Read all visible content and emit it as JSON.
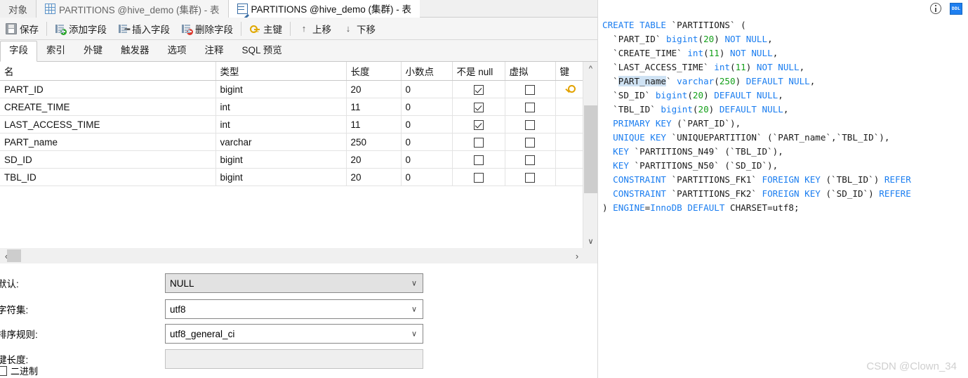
{
  "tabs": [
    {
      "label": "对象",
      "icon": "none",
      "state": "plain"
    },
    {
      "label": "PARTITIONS @hive_demo (集群) - 表",
      "icon": "grid-table-icon",
      "state": "inactive"
    },
    {
      "label": "PARTITIONS @hive_demo (集群) - 表",
      "icon": "design-table-icon",
      "state": "active"
    }
  ],
  "toolbar": {
    "save": "保存",
    "add_field": "添加字段",
    "insert_field": "插入字段",
    "delete_field": "删除字段",
    "primary_key": "主键",
    "move_up": "上移",
    "move_down": "下移"
  },
  "subtabs": [
    {
      "label": "字段",
      "active": true
    },
    {
      "label": "索引",
      "active": false
    },
    {
      "label": "外键",
      "active": false
    },
    {
      "label": "触发器",
      "active": false
    },
    {
      "label": "选项",
      "active": false
    },
    {
      "label": "注释",
      "active": false
    },
    {
      "label": "SQL 预览",
      "active": false
    }
  ],
  "grid": {
    "columns": [
      "名",
      "类型",
      "长度",
      "小数点",
      "不是 null",
      "虚拟",
      "键"
    ],
    "rows": [
      {
        "name": "PART_ID",
        "type": "bigint",
        "length": "20",
        "decimals": "0",
        "not_null": true,
        "virtual": false,
        "key": "primary-key-icon"
      },
      {
        "name": "CREATE_TIME",
        "type": "int",
        "length": "11",
        "decimals": "0",
        "not_null": true,
        "virtual": false,
        "key": ""
      },
      {
        "name": "LAST_ACCESS_TIME",
        "type": "int",
        "length": "11",
        "decimals": "0",
        "not_null": true,
        "virtual": false,
        "key": ""
      },
      {
        "name": "PART_name",
        "type": "varchar",
        "length": "250",
        "decimals": "0",
        "not_null": false,
        "virtual": false,
        "key": ""
      },
      {
        "name": "SD_ID",
        "type": "bigint",
        "length": "20",
        "decimals": "0",
        "not_null": false,
        "virtual": false,
        "key": ""
      },
      {
        "name": "TBL_ID",
        "type": "bigint",
        "length": "20",
        "decimals": "0",
        "not_null": false,
        "virtual": false,
        "key": ""
      }
    ]
  },
  "properties": {
    "default_label": "默认:",
    "default_value": "NULL",
    "charset_label": "字符集:",
    "charset_value": "utf8",
    "collation_label": "排序规则:",
    "collation_value": "utf8_general_ci",
    "keylen_label": "键长度:",
    "keylen_value": "",
    "binary_label": "二进制",
    "binary_checked": false
  },
  "right_panel": {
    "info_icon": "info-icon",
    "ddl_button": "DDL"
  },
  "sql": {
    "lines": [
      [
        {
          "t": "CREATE",
          "c": "k"
        },
        {
          "t": " ",
          "c": "p"
        },
        {
          "t": "TABLE",
          "c": "k"
        },
        {
          "t": " `PARTITIONS` (",
          "c": "id"
        }
      ],
      [
        {
          "t": "  `PART_ID` ",
          "c": "id"
        },
        {
          "t": "bigint",
          "c": "t"
        },
        {
          "t": "(",
          "c": "id"
        },
        {
          "t": "20",
          "c": "n"
        },
        {
          "t": ") ",
          "c": "id"
        },
        {
          "t": "NOT NULL",
          "c": "k"
        },
        {
          "t": ",",
          "c": "id"
        }
      ],
      [
        {
          "t": "  `CREATE_TIME` ",
          "c": "id"
        },
        {
          "t": "int",
          "c": "t"
        },
        {
          "t": "(",
          "c": "id"
        },
        {
          "t": "11",
          "c": "n"
        },
        {
          "t": ") ",
          "c": "id"
        },
        {
          "t": "NOT NULL",
          "c": "k"
        },
        {
          "t": ",",
          "c": "id"
        }
      ],
      [
        {
          "t": "  `LAST_ACCESS_TIME` ",
          "c": "id"
        },
        {
          "t": "int",
          "c": "t"
        },
        {
          "t": "(",
          "c": "id"
        },
        {
          "t": "11",
          "c": "n"
        },
        {
          "t": ") ",
          "c": "id"
        },
        {
          "t": "NOT NULL",
          "c": "k"
        },
        {
          "t": ",",
          "c": "id"
        }
      ],
      [
        {
          "t": "  `",
          "c": "id"
        },
        {
          "t": "PART_name",
          "c": "id sel"
        },
        {
          "t": "` ",
          "c": "id"
        },
        {
          "t": "varchar",
          "c": "t"
        },
        {
          "t": "(",
          "c": "id"
        },
        {
          "t": "250",
          "c": "n"
        },
        {
          "t": ") ",
          "c": "id"
        },
        {
          "t": "DEFAULT NULL",
          "c": "k"
        },
        {
          "t": ",",
          "c": "id"
        }
      ],
      [
        {
          "t": "  `SD_ID` ",
          "c": "id"
        },
        {
          "t": "bigint",
          "c": "t"
        },
        {
          "t": "(",
          "c": "id"
        },
        {
          "t": "20",
          "c": "n"
        },
        {
          "t": ") ",
          "c": "id"
        },
        {
          "t": "DEFAULT NULL",
          "c": "k"
        },
        {
          "t": ",",
          "c": "id"
        }
      ],
      [
        {
          "t": "  `TBL_ID` ",
          "c": "id"
        },
        {
          "t": "bigint",
          "c": "t"
        },
        {
          "t": "(",
          "c": "id"
        },
        {
          "t": "20",
          "c": "n"
        },
        {
          "t": ") ",
          "c": "id"
        },
        {
          "t": "DEFAULT NULL",
          "c": "k"
        },
        {
          "t": ",",
          "c": "id"
        }
      ],
      [
        {
          "t": "  ",
          "c": "id"
        },
        {
          "t": "PRIMARY KEY",
          "c": "k"
        },
        {
          "t": " (`PART_ID`),",
          "c": "id"
        }
      ],
      [
        {
          "t": "  ",
          "c": "id"
        },
        {
          "t": "UNIQUE KEY",
          "c": "k"
        },
        {
          "t": " `UNIQUEPARTITION` (`PART_name`,`TBL_ID`),",
          "c": "id"
        }
      ],
      [
        {
          "t": "  ",
          "c": "id"
        },
        {
          "t": "KEY",
          "c": "k"
        },
        {
          "t": " `PARTITIONS_N49` (`TBL_ID`),",
          "c": "id"
        }
      ],
      [
        {
          "t": "  ",
          "c": "id"
        },
        {
          "t": "KEY",
          "c": "k"
        },
        {
          "t": " `PARTITIONS_N50` (`SD_ID`),",
          "c": "id"
        }
      ],
      [
        {
          "t": "  ",
          "c": "id"
        },
        {
          "t": "CONSTRAINT",
          "c": "k"
        },
        {
          "t": " `PARTITIONS_FK1` ",
          "c": "id"
        },
        {
          "t": "FOREIGN KEY",
          "c": "k"
        },
        {
          "t": " (`TBL_ID`) ",
          "c": "id"
        },
        {
          "t": "REFER",
          "c": "k"
        }
      ],
      [
        {
          "t": "  ",
          "c": "id"
        },
        {
          "t": "CONSTRAINT",
          "c": "k"
        },
        {
          "t": " `PARTITIONS_FK2` ",
          "c": "id"
        },
        {
          "t": "FOREIGN KEY",
          "c": "k"
        },
        {
          "t": " (`SD_ID`) ",
          "c": "id"
        },
        {
          "t": "REFERE",
          "c": "k"
        }
      ],
      [
        {
          "t": ") ",
          "c": "id"
        },
        {
          "t": "ENGINE",
          "c": "k"
        },
        {
          "t": "=",
          "c": "id"
        },
        {
          "t": "InnoDB",
          "c": "k"
        },
        {
          "t": " ",
          "c": "id"
        },
        {
          "t": "DEFAULT",
          "c": "k"
        },
        {
          "t": " CHARSET=utf8;",
          "c": "id"
        }
      ]
    ]
  },
  "watermark": "CSDN @Clown_34",
  "colors": {
    "sql_keyword": "#1a7df0",
    "sql_number": "#14a01a",
    "sql_identifier": "#1a1a1a",
    "selection": "#cfe2f3",
    "key_icon": "#e2a200",
    "ddl_accent": "#1e7ff0"
  }
}
